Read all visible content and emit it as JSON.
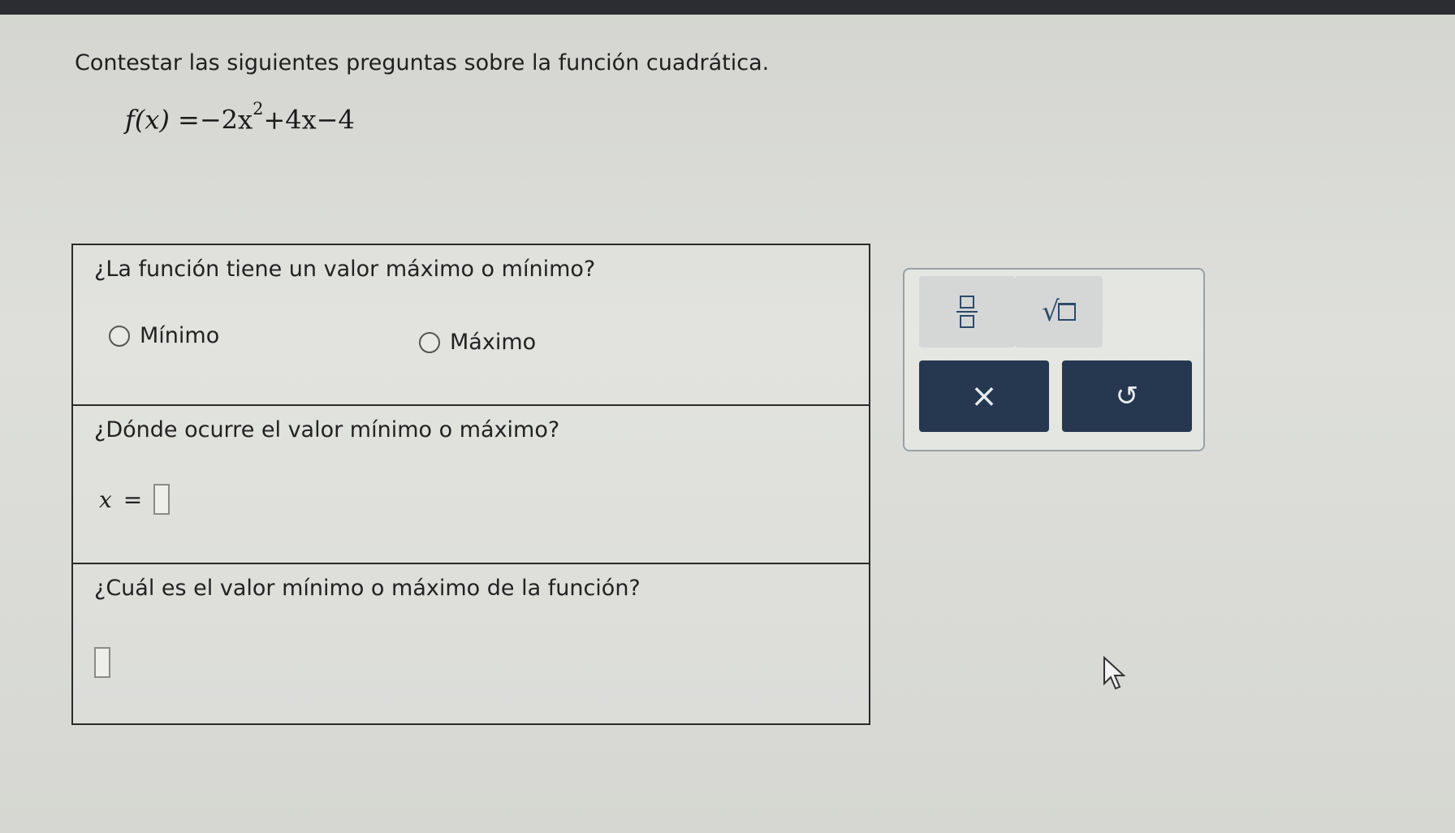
{
  "header": {
    "prompt": "Contestar las siguientes preguntas sobre la función cuadrática."
  },
  "function": {
    "lhs": "f(x)",
    "equals": "=",
    "term1": "−2x",
    "exponent": "2",
    "rest": "+4x−4"
  },
  "questions": [
    {
      "text": "¿La función tiene un valor máximo o mínimo?",
      "options": [
        "Mínimo",
        "Máximo"
      ]
    },
    {
      "text": "¿Dónde ocurre el valor mínimo o máximo?",
      "variable": "x",
      "equals": "=",
      "answer": ""
    },
    {
      "text": "¿Cuál es el valor mínimo o máximo de la función?",
      "answer": ""
    }
  ],
  "toolbar": {
    "fraction_icon": "fraction-icon",
    "sqrt_icon": "square-root-icon",
    "sqrt_symbol": "√",
    "clear_symbol": "×",
    "undo_symbol": "↺"
  },
  "colors": {
    "button_bg": "#26384f",
    "icon_color": "#2c4a6a",
    "border": "#2a2a2a"
  }
}
